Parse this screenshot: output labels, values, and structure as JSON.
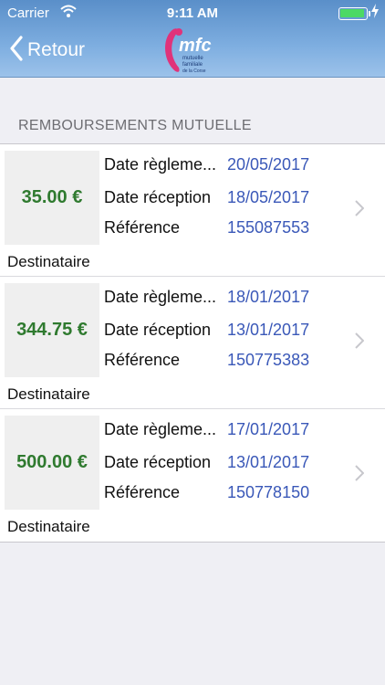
{
  "status": {
    "carrier": "Carrier",
    "time": "9:11 AM",
    "battery_level": 0.9
  },
  "nav": {
    "back_label": "Retour",
    "logo_text": "mfc",
    "logo_subtext": [
      "mutuelle",
      "familiale",
      "de la Corse"
    ]
  },
  "section": {
    "title": "REMBOURSEMENTS MUTUELLE"
  },
  "labels": {
    "date_reglement": "Date règleme...",
    "date_reception": "Date réception",
    "reference": "Référence",
    "destinataire": "Destinataire"
  },
  "reimbursements": [
    {
      "amount": "35.00 €",
      "date_reglement": "20/05/2017",
      "date_reception": "18/05/2017",
      "reference": "155087553"
    },
    {
      "amount": "344.75 €",
      "date_reglement": "18/01/2017",
      "date_reception": "13/01/2017",
      "reference": "150775383"
    },
    {
      "amount": "500.00 €",
      "date_reglement": "17/01/2017",
      "date_reception": "13/01/2017",
      "reference": "150778150"
    }
  ],
  "colors": {
    "amount": "#2f7a2f",
    "value": "#3a58b8",
    "nav_top": "#5a8fc9",
    "logo_pink": "#e0337a",
    "battery": "#4cd964"
  }
}
